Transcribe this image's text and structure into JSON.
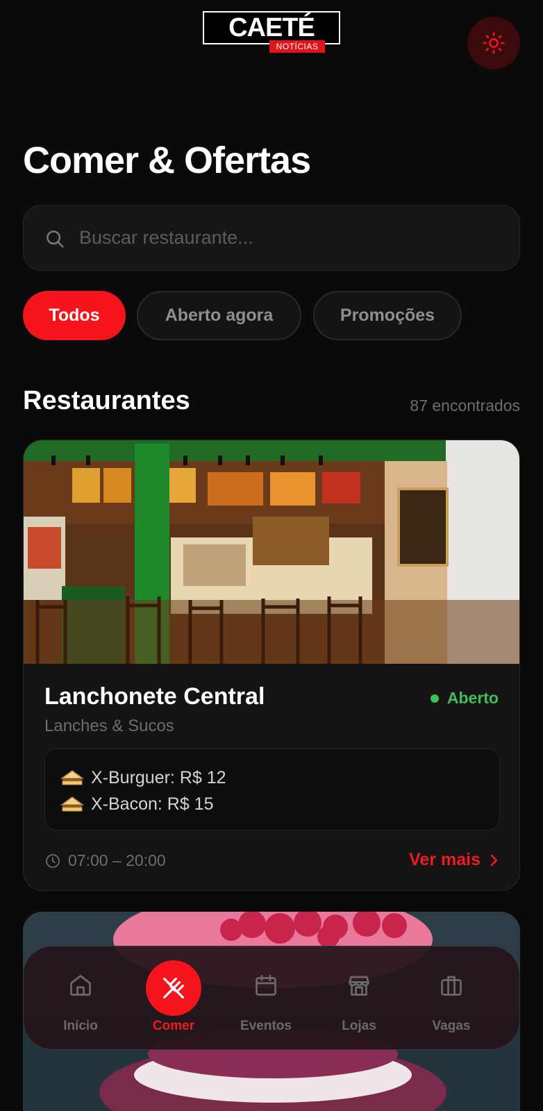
{
  "brand": {
    "name": "CAETÉ",
    "tagline": "NOTÍCIAS",
    "accent_color": "#f5141b"
  },
  "header": {
    "theme_icon": "sun-icon"
  },
  "page": {
    "title": "Comer & Ofertas"
  },
  "search": {
    "placeholder": "Buscar restaurante...",
    "value": ""
  },
  "filters": [
    {
      "label": "Todos",
      "active": true
    },
    {
      "label": "Aberto agora",
      "active": false
    },
    {
      "label": "Promoções",
      "active": false
    }
  ],
  "section": {
    "title": "Restaurantes",
    "count": "87 encontrados"
  },
  "restaurants": [
    {
      "name": "Lanchonete Central",
      "category": "Lanches & Sucos",
      "status": "Aberto",
      "status_color": "#3fbf5a",
      "deals": [
        {
          "icon": "sandwich-icon",
          "text": "X-Burguer: R$ 12"
        },
        {
          "icon": "sandwich-icon",
          "text": "X-Bacon: R$ 15"
        }
      ],
      "hours": "07:00 – 20:00",
      "more_label": "Ver mais"
    }
  ],
  "nav": [
    {
      "label": "Início",
      "icon": "home-icon",
      "active": false
    },
    {
      "label": "Comer",
      "icon": "utensils-icon",
      "active": true
    },
    {
      "label": "Eventos",
      "icon": "calendar-icon",
      "active": false
    },
    {
      "label": "Lojas",
      "icon": "store-icon",
      "active": false
    },
    {
      "label": "Vagas",
      "icon": "briefcase-icon",
      "active": false
    }
  ]
}
